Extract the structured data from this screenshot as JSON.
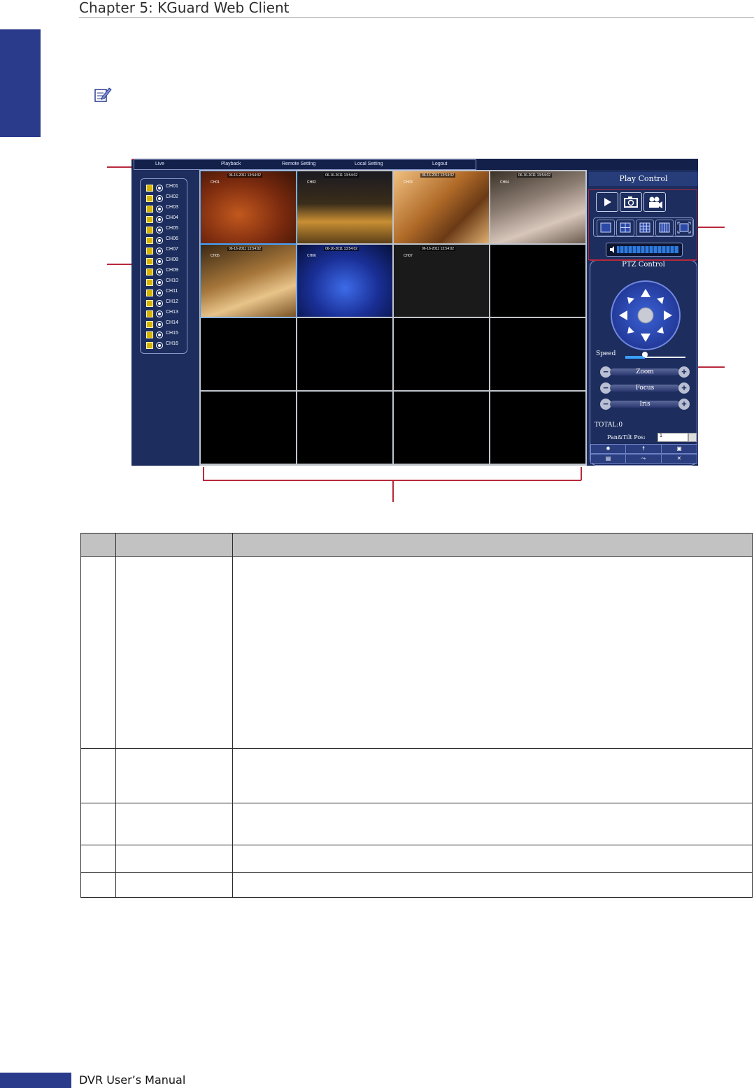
{
  "header": {
    "chapter_title": "Chapter 5: KGuard Web Client"
  },
  "footer": {
    "manual_title": "DVR User’s Manual"
  },
  "screenshot": {
    "menu": [
      "Live",
      "Playback",
      "Remote Setting",
      "Local Setting",
      "Logout"
    ],
    "channels": [
      "CH01",
      "CH02",
      "CH03",
      "CH04",
      "CH05",
      "CH06",
      "CH07",
      "CH08",
      "CH09",
      "CH10",
      "CH11",
      "CH12",
      "CH13",
      "CH14",
      "CH15",
      "CH16"
    ],
    "cameras": [
      {
        "timestamp": "06-16-2011 13:54:02",
        "label": "CH01"
      },
      {
        "timestamp": "06-16-2011 13:54:02",
        "label": "CH02"
      },
      {
        "timestamp": "06-16-2011 13:54:02",
        "label": "CH03"
      },
      {
        "timestamp": "06-16-2011 13:54:02",
        "label": "CH04"
      },
      {
        "timestamp": "06-16-2011 13:54:02",
        "label": "CH05"
      },
      {
        "timestamp": "06-16-2011 13:54:02",
        "label": "CH06"
      },
      {
        "timestamp": "06-16-2011 13:54:02",
        "label": "CH07"
      }
    ],
    "play_control": {
      "title": "Play Control"
    },
    "ptz": {
      "title": "PTZ Control",
      "speed_label": "Speed",
      "speed_level": 0.33,
      "zoom": "Zoom",
      "focus": "Focus",
      "iris": "Iris",
      "total": "TOTAL:0",
      "pan_tilt_label": "Pan&Tilt Pos:",
      "pan_tilt_value": "1"
    },
    "colors": {
      "panel": "#1c2d5e",
      "callout": "#b8293b",
      "accent_tab": "#2b3b8c"
    }
  }
}
